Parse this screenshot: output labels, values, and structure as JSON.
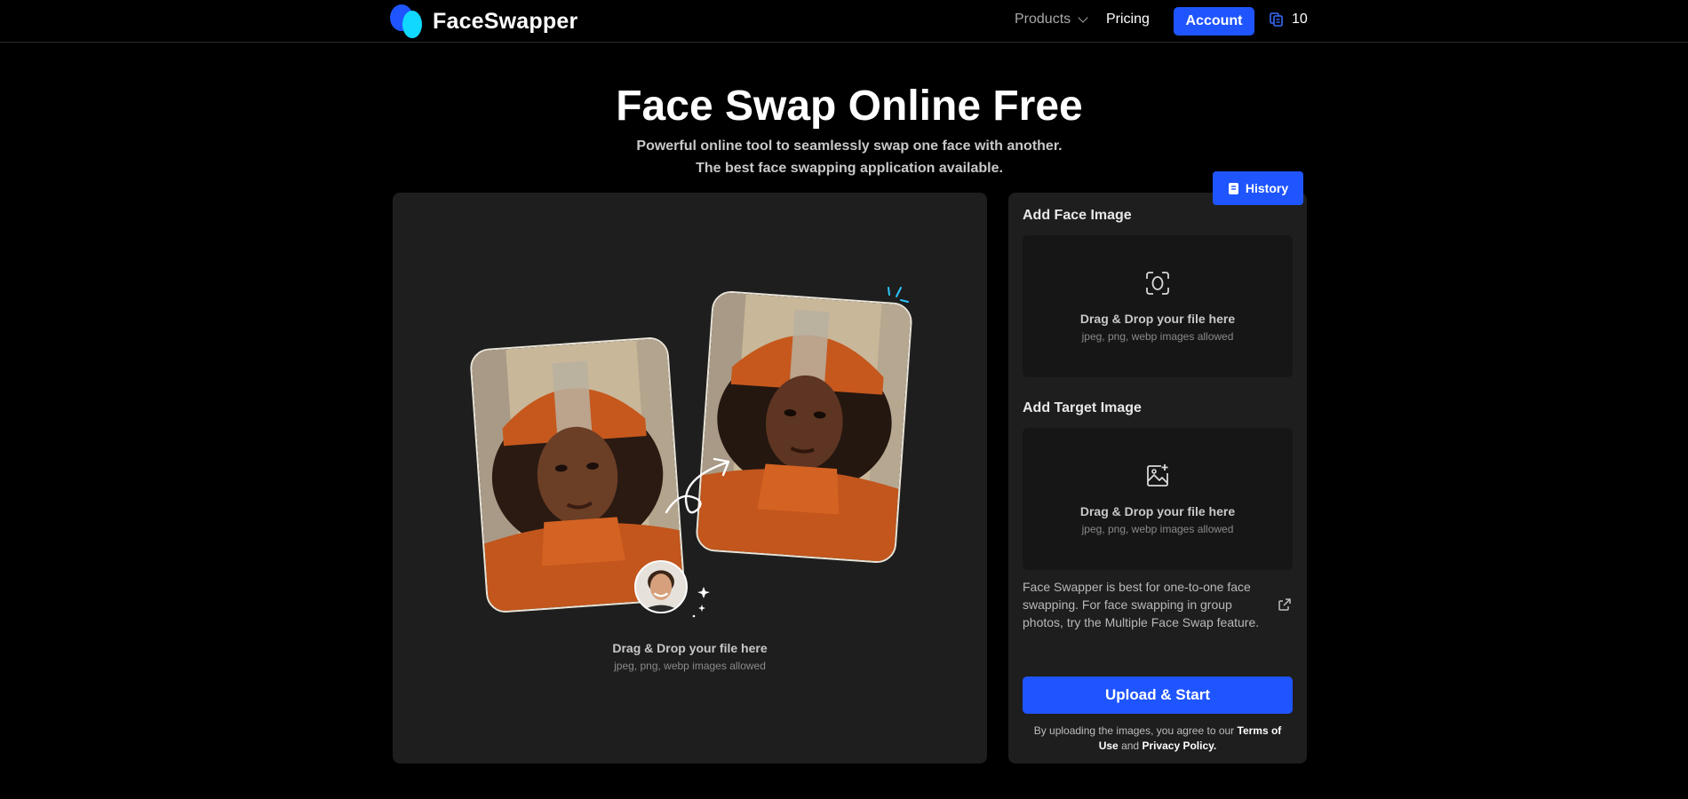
{
  "nav": {
    "brand": "FaceSwapper",
    "products": "Products",
    "pricing": "Pricing",
    "account": "Account",
    "credits": "10"
  },
  "hero": {
    "title": "Face Swap Online Free",
    "subtitle": "Powerful online tool to seamlessly swap one face with another. The best face swapping application available."
  },
  "preview": {
    "drop_title": "Drag & Drop your file here",
    "drop_formats": "jpeg, png, webp images allowed"
  },
  "panel": {
    "history": "History",
    "face": {
      "label": "Add Face Image",
      "drop_title": "Drag & Drop your file here",
      "drop_formats": "jpeg, png, webp images allowed"
    },
    "target": {
      "label": "Add Target Image",
      "drop_title": "Drag & Drop your file here",
      "drop_formats": "jpeg, png, webp images allowed"
    },
    "note": "Face Swapper is best for one-to-one face swapping. For face swapping in group photos, try the Multiple Face Swap feature.",
    "upload": "Upload & Start",
    "terms_prefix": "By uploading the images, you agree to our",
    "terms_link": "Terms of Use",
    "terms_and": "and",
    "privacy_link": "Privacy Policy."
  },
  "colors": {
    "accent": "#1f55ff",
    "background": "#000000",
    "panel": "#1e1e1e"
  },
  "icons": [
    "logo-mark",
    "chevron-down-icon",
    "credits-stack-icon",
    "history-icon",
    "face-scan-icon",
    "image-add-icon",
    "external-link-icon",
    "swap-arrow-icon",
    "sparkle-icon"
  ]
}
